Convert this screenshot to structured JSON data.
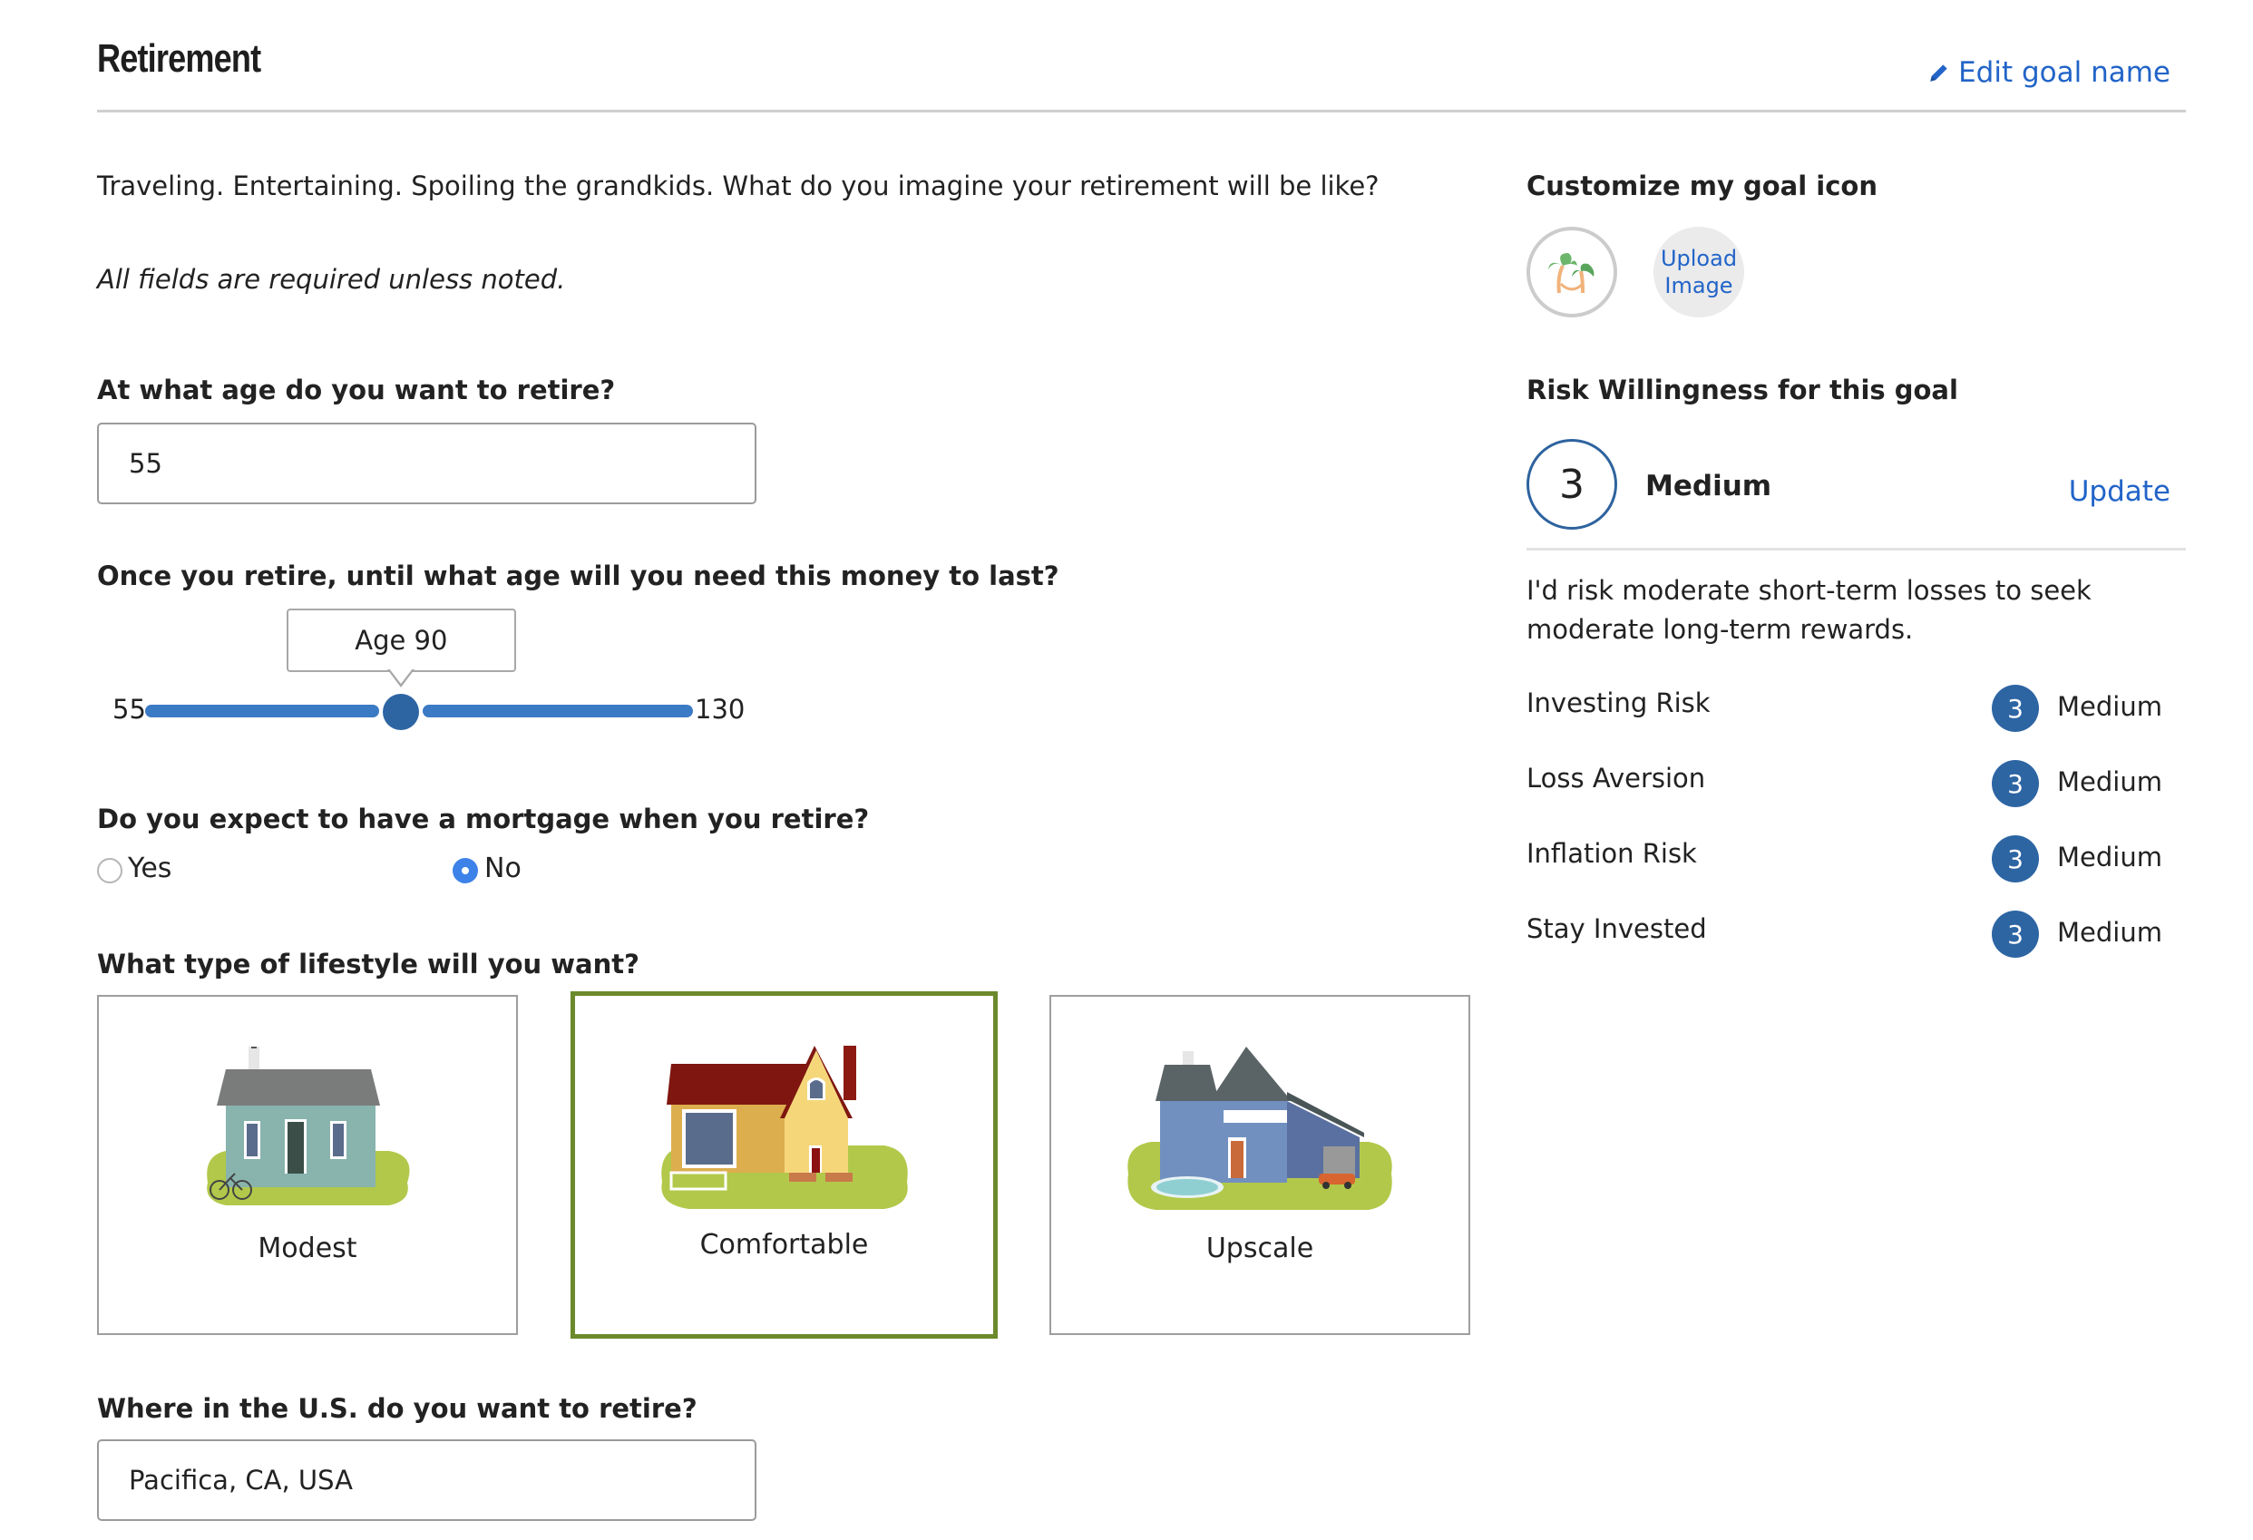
{
  "header": {
    "title": "Retirement",
    "edit_goal_label": "Edit goal name"
  },
  "intro": {
    "text": "Traveling. Entertaining. Spoiling the grandkids. What do you imagine your retirement will be like?",
    "required_note": "All fields are required unless noted."
  },
  "form": {
    "retire_age": {
      "label": "At what age do you want to retire?",
      "value": "55"
    },
    "money_last_age": {
      "label": "Once you retire, until what age will you need this money to last?",
      "tooltip": "Age 90",
      "min_label": "55",
      "max_label": "130",
      "min": 55,
      "max": 130,
      "value": 90
    },
    "mortgage": {
      "label": "Do you expect to have a mortgage when you retire?",
      "options": [
        {
          "label": "Yes",
          "checked": false
        },
        {
          "label": "No",
          "checked": true
        }
      ]
    },
    "lifestyle": {
      "label": "What type of lifestyle will you want?",
      "options": [
        {
          "label": "Modest",
          "selected": false
        },
        {
          "label": "Comfortable",
          "selected": true
        },
        {
          "label": "Upscale",
          "selected": false
        }
      ]
    },
    "location": {
      "label": "Where in the U.S. do you want to retire?",
      "value": "Pacifica, CA, USA"
    }
  },
  "goal_icon": {
    "heading": "Customize my goal icon",
    "current_icon": "palm-trees-hammock-icon",
    "upload_line1": "Upload",
    "upload_line2": "Image"
  },
  "risk": {
    "heading": "Risk Willingness for this goal",
    "score": "3",
    "level": "Medium",
    "update_label": "Update",
    "description": "I'd risk moderate short-term losses to seek moderate long-term rewards.",
    "rows": [
      {
        "label": "Investing Risk",
        "score": "3",
        "level": "Medium"
      },
      {
        "label": "Loss Aversion",
        "score": "3",
        "level": "Medium"
      },
      {
        "label": "Inflation Risk",
        "score": "3",
        "level": "Medium"
      },
      {
        "label": "Stay Invested",
        "score": "3",
        "level": "Medium"
      }
    ]
  },
  "colors": {
    "link": "#2264c8",
    "accent": "#2d65a3",
    "slider": "#3b7ac4",
    "selected_card_border": "#6b8a2c",
    "radio_checked": "#3d82e8"
  }
}
